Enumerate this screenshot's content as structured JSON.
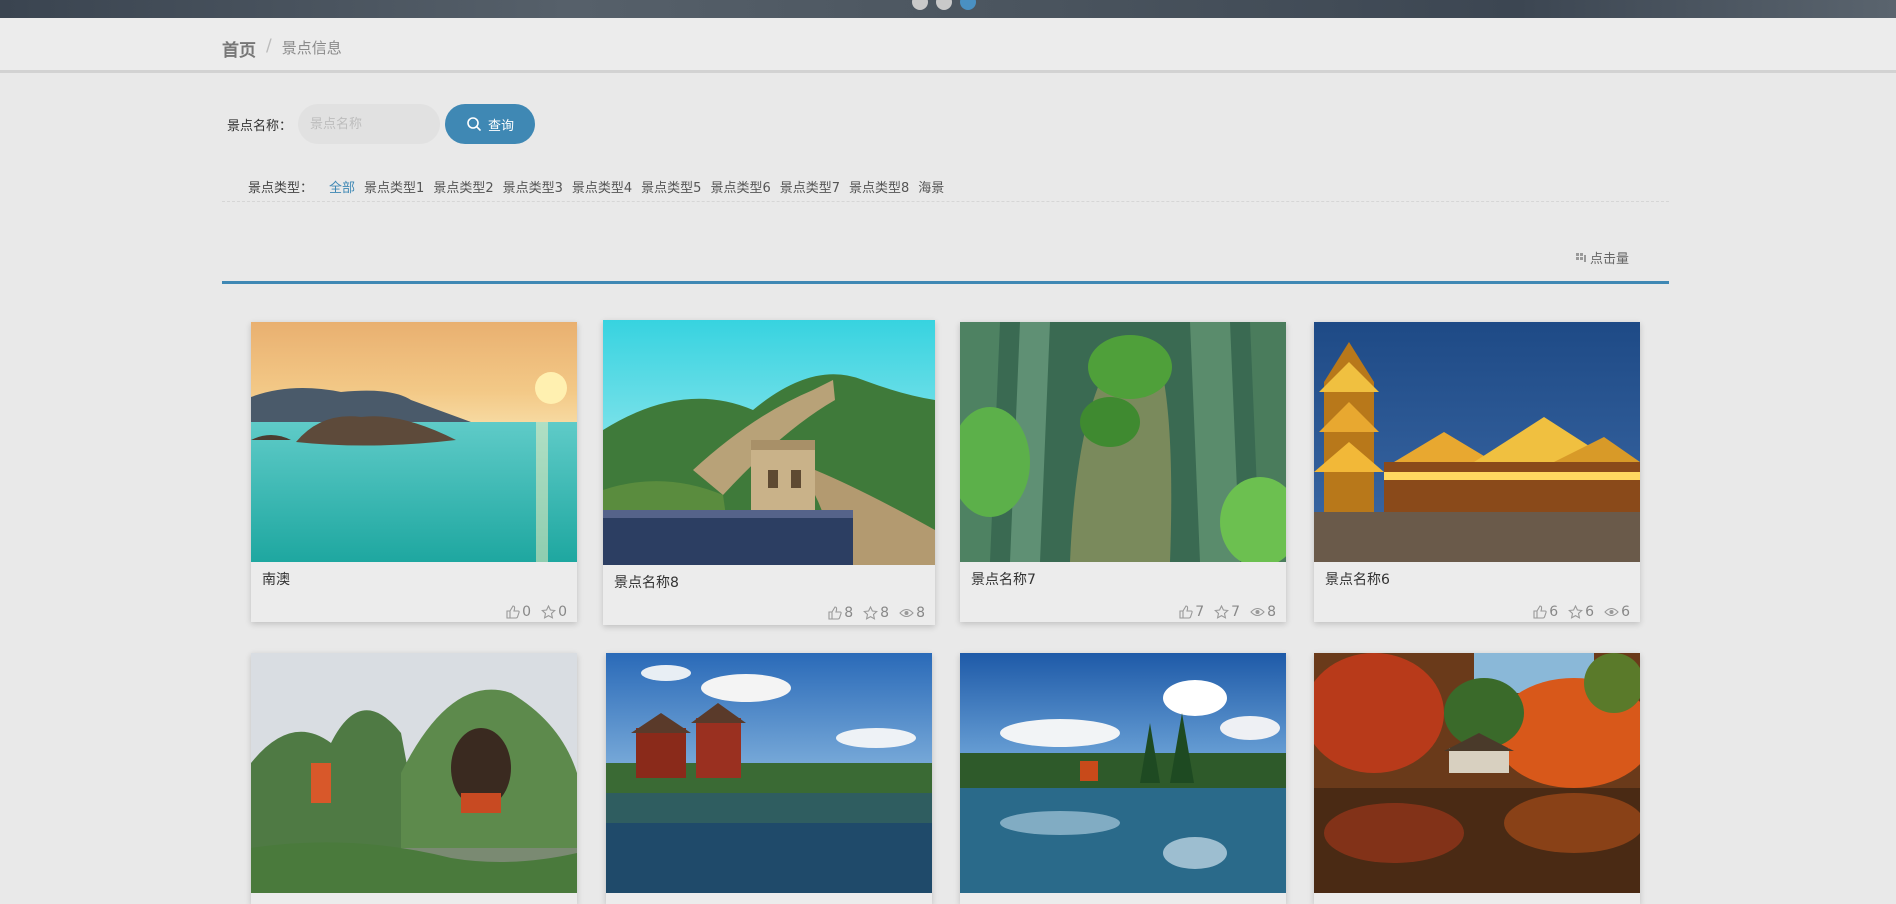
{
  "breadcrumb": {
    "home": "首页",
    "separator": "/",
    "current": "景点信息"
  },
  "search": {
    "label": "景点名称：",
    "placeholder": "景点名称",
    "value": "",
    "button_label": "查询",
    "button_icon": "search-icon"
  },
  "categories": {
    "label": "景点类型：",
    "items": [
      "全部",
      "景点类型1",
      "景点类型2",
      "景点类型3",
      "景点类型4",
      "景点类型5",
      "景点类型6",
      "景点类型7",
      "景点类型8",
      "海景"
    ],
    "active": "全部"
  },
  "sort": {
    "label": "点击量",
    "icon": "sort-icon"
  },
  "colors": {
    "accent": "#3f88b4",
    "background": "#e9e9e9"
  },
  "cards": [
    {
      "name": "南澳",
      "likes": "0",
      "favorites": "0",
      "views": ""
    },
    {
      "name": "景点名称8",
      "likes": "8",
      "favorites": "8",
      "views": "8"
    },
    {
      "name": "景点名称7",
      "likes": "7",
      "favorites": "7",
      "views": "8"
    },
    {
      "name": "景点名称6",
      "likes": "6",
      "favorites": "6",
      "views": "6"
    },
    {
      "name": "",
      "likes": "",
      "favorites": "",
      "views": ""
    },
    {
      "name": "",
      "likes": "",
      "favorites": "",
      "views": ""
    },
    {
      "name": "",
      "likes": "",
      "favorites": "",
      "views": ""
    },
    {
      "name": "",
      "likes": "",
      "favorites": "",
      "views": ""
    }
  ]
}
